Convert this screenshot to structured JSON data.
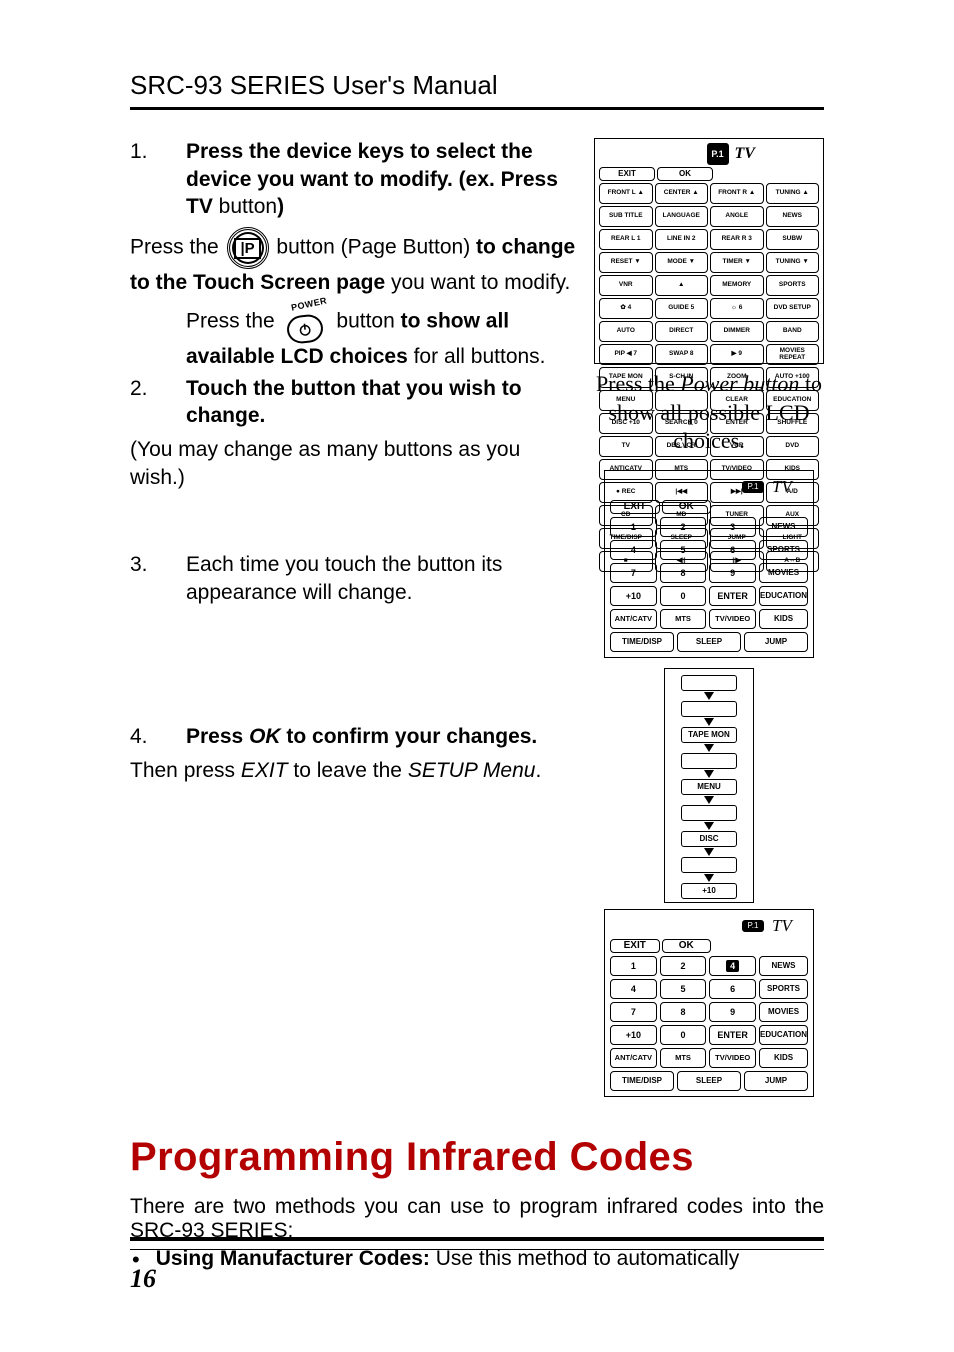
{
  "header": "SRC-93 SERIES User's Manual",
  "step1": {
    "num": "1.",
    "line1_pre": "Press the device  keys to select the device you want to modify. (ex. Press TV",
    "line1_btn": " button",
    "line1_close": ")",
    "press": "Press the ",
    "page_btn_post": " button (Page Button) ",
    "change": "to change to the Touch Screen page",
    "change_post": " you want to modify.",
    "press2": "Press the ",
    "show": "to show all available LCD choices",
    "show_post": " for all buttons.",
    "power_label": "POWER"
  },
  "step2": {
    "num": "2.",
    "title": "Touch the button that you wish to change.",
    "note": "(You may change as many buttons as you wish.)"
  },
  "step3": {
    "num": "3.",
    "text": "Each time you touch the button its appearance will change."
  },
  "step4": {
    "num": "4.",
    "title_pre": "Press ",
    "title_ok": "OK",
    "title_post": " to confirm your changes.",
    "then_pre": "Then press ",
    "exit": "EXIT",
    "then_mid": " to leave the ",
    "setup": "SETUP Menu",
    "then_end": "."
  },
  "caption": {
    "pre": "Press the ",
    "pwr": "Power button",
    "post": " to show all possible LCD choices."
  },
  "dense": {
    "exit": "EXIT",
    "ok": "OK",
    "pbadge": "P.1",
    "tv": "TV",
    "rows": [
      [
        "FRONT L ▲",
        "CENTER ▲",
        "FRONT R ▲",
        "TUNING ▲"
      ],
      [
        "SUB TITLE",
        "LANGUAGE",
        "ANGLE",
        "NEWS"
      ],
      [
        "REAR L 1",
        "LINE IN 2",
        "REAR R 3",
        "SUBW"
      ],
      [
        "RESET ▼",
        "MODE ▼",
        "TIMER ▼",
        "TUNING ▼"
      ],
      [
        "VNR",
        "▲",
        "MEMORY",
        "SPORTS"
      ],
      [
        "✿ 4",
        "GUIDE 5",
        "☼ 6",
        "DVD SETUP"
      ],
      [
        "AUTO",
        "DIRECT",
        "DIMMER",
        "BAND"
      ],
      [
        "PIP ◀ 7",
        "SWAP 8",
        "▶ 9",
        "MOVIES REPEAT"
      ],
      [
        "TAPE MON",
        "S-CH IN",
        "ZOOM",
        "AUTO +100"
      ],
      [
        "MENU",
        "",
        "CLEAR",
        "EDUCATION"
      ],
      [
        "DISC +10",
        "SEARCH 0",
        "ENTER",
        "SHUFFLE"
      ],
      [
        "TV",
        "DBS  VCR",
        "VCR",
        "DVD"
      ],
      [
        "ANTICATV",
        "MTS",
        "TV/VIDEO",
        "KIDS"
      ],
      [
        "● REC",
        "|◀◀",
        "▶▶|",
        "A/D"
      ],
      [
        "CD",
        "MD",
        "TUNER",
        "AUX"
      ],
      [
        "TIME/DISP",
        "SLEEP",
        "JUMP",
        "LIGHT"
      ],
      [
        "■",
        "◀||",
        "||▶",
        "A↔B"
      ]
    ]
  },
  "keypad": {
    "pbadge": "P.1",
    "tv": "TV",
    "exit": "EXIT",
    "ok": "OK",
    "cats": [
      "NEWS",
      "SPORTS",
      "MOVIES",
      "EDUCATION",
      "KIDS"
    ],
    "nums": [
      "1",
      "2",
      "3",
      "4",
      "5",
      "6",
      "7",
      "8",
      "9",
      "+10",
      "0",
      "ENTER"
    ],
    "row5": [
      "ANT/CATV",
      "MTS",
      "TV/VIDEO"
    ],
    "btm": [
      "TIME/DISP",
      "SLEEP",
      "JUMP"
    ],
    "shade_index": 9,
    "shade_labels": [
      "",
      "2",
      ""
    ],
    "shade_top": [
      "",
      "",
      "4",
      ""
    ]
  },
  "cycle": [
    "",
    "",
    "TAPE MON",
    "",
    "MENU",
    "",
    "DISC",
    "",
    "+10"
  ],
  "h2": "Programming Infrared Codes",
  "intro": "There are two methods you can use to program infrared codes into the SRC-93 SERIES:",
  "bullet_b": "Using Manufacturer Codes:",
  "bullet_rest": " Use this method to automatically",
  "page_num": "16"
}
